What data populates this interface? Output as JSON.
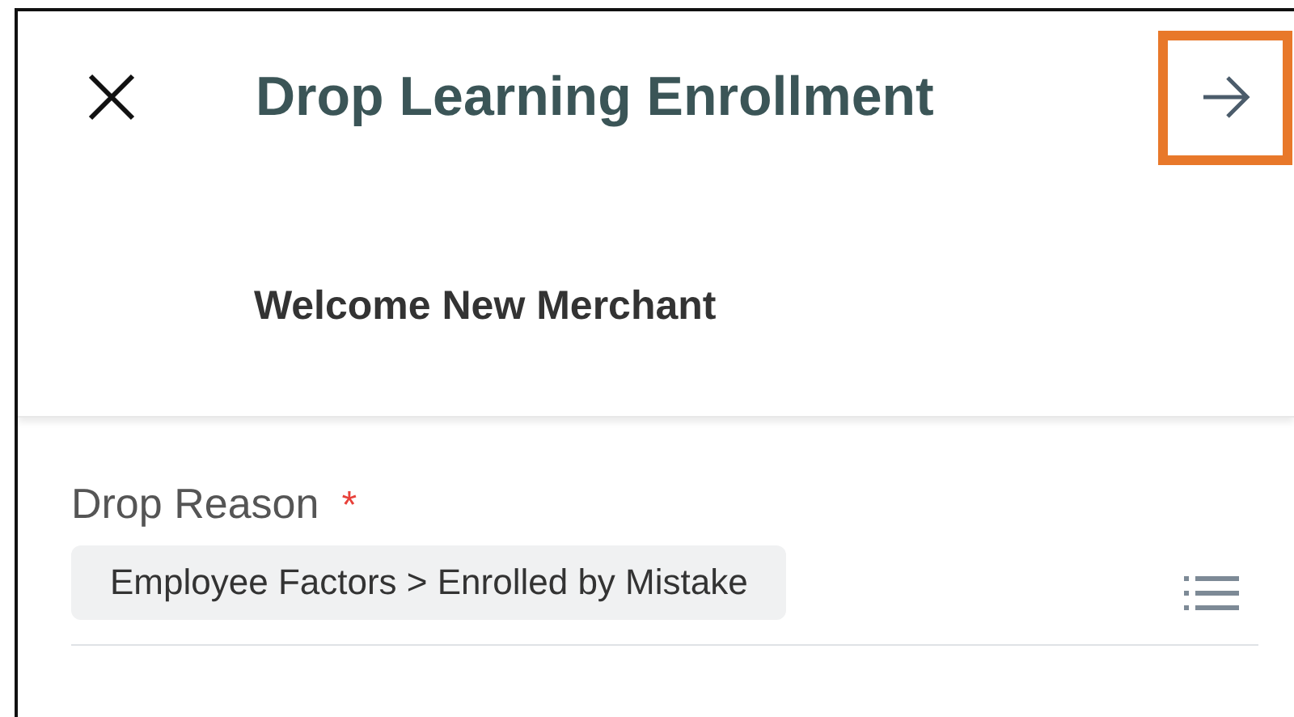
{
  "header": {
    "title": "Drop Learning Enrollment",
    "subtitle": "Welcome New Merchant",
    "forward_button": {
      "highlighted": true
    }
  },
  "field": {
    "label": "Drop Reason",
    "required_mark": "*",
    "value": "Employee Factors > Enrolled by Mistake"
  }
}
